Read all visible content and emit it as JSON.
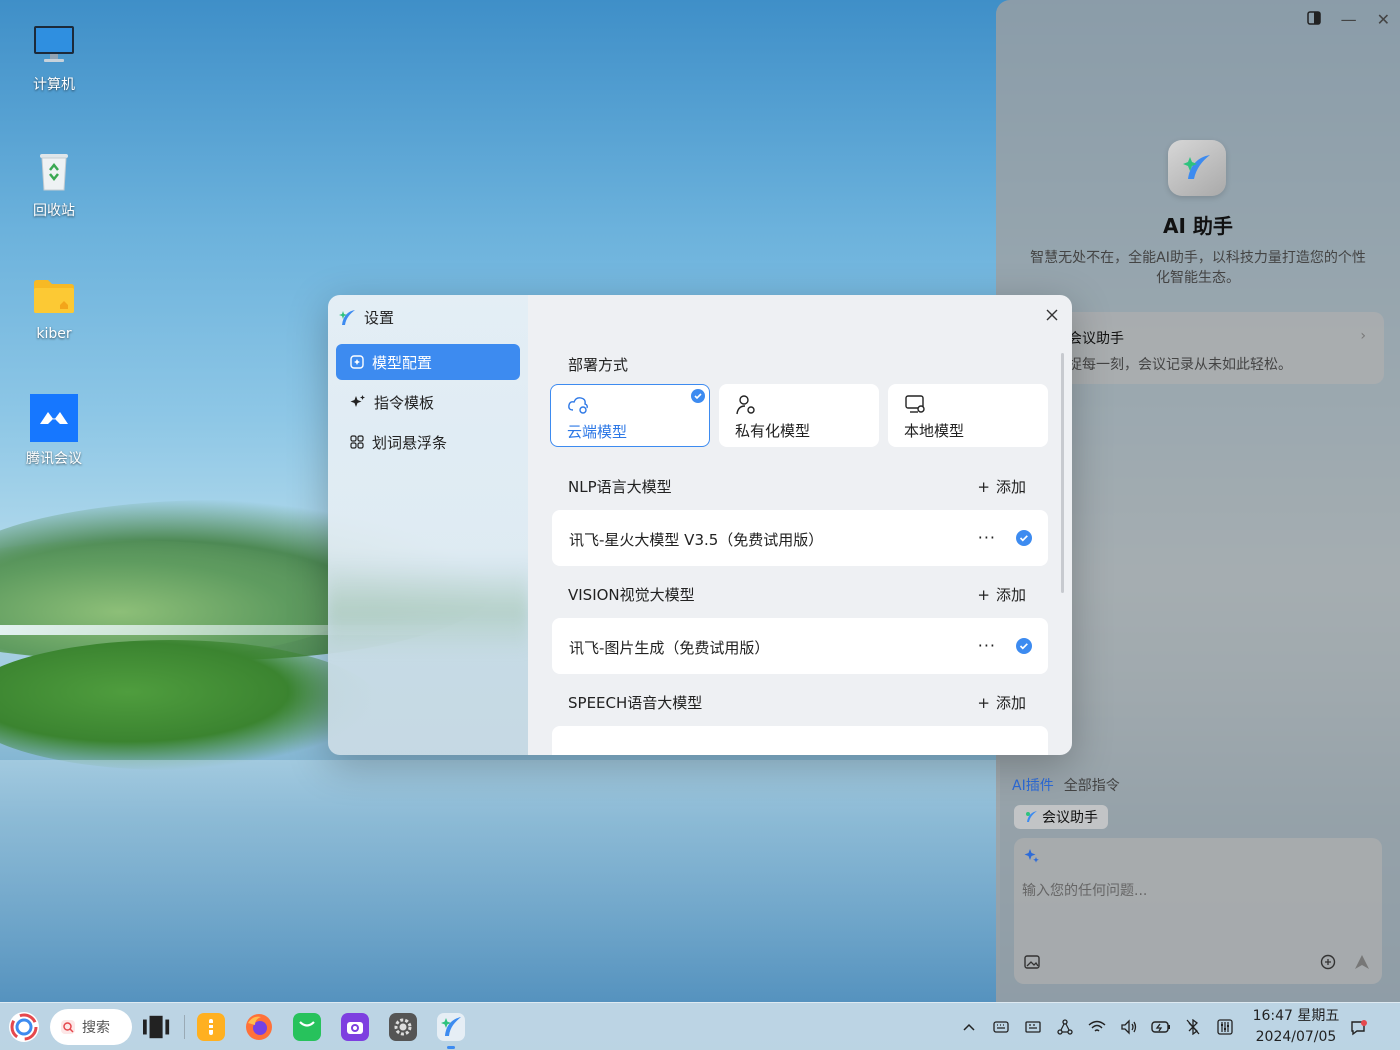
{
  "desktop": {
    "icons": [
      {
        "label": "计算机",
        "icon": "computer-icon"
      },
      {
        "label": "回收站",
        "icon": "trash-icon"
      },
      {
        "label": "kiber",
        "icon": "folder-icon"
      },
      {
        "label": "腾讯会议",
        "icon": "tencent-meeting-icon"
      }
    ]
  },
  "ai_panel": {
    "title": "AI 助手",
    "description": "智慧无处不在，全能AI助手，以科技力量打造您的个性化智能生态。",
    "plugin_card": {
      "title": "会议助手",
      "subtitle": "捉每一刻，会议记录从未如此轻松。"
    },
    "tabs": [
      "AI插件",
      "全部指令"
    ],
    "chip_label": "会议助手",
    "input_placeholder": "输入您的任何问题..."
  },
  "settings": {
    "title": "设置",
    "nav": [
      {
        "label": "模型配置",
        "icon": "model-config-icon",
        "active": true
      },
      {
        "label": "指令模板",
        "icon": "sparkle-icon",
        "active": false
      },
      {
        "label": "划词悬浮条",
        "icon": "grid-icon",
        "active": false
      }
    ],
    "deploy": {
      "section_title": "部署方式",
      "options": [
        {
          "label": "云端模型",
          "icon": "cloud-gear-icon",
          "selected": true
        },
        {
          "label": "私有化模型",
          "icon": "user-gear-icon",
          "selected": false
        },
        {
          "label": "本地模型",
          "icon": "monitor-gear-icon",
          "selected": false
        }
      ]
    },
    "add_label": "添加",
    "sections": [
      {
        "title": "NLP语言大模型",
        "models": [
          {
            "name": "讯飞-星火大模型 V3.5（免费试用版）",
            "checked": true
          }
        ]
      },
      {
        "title": "VISION视觉大模型",
        "models": [
          {
            "name": "讯飞-图片生成（免费试用版）",
            "checked": true
          }
        ]
      },
      {
        "title": "SPEECH语音大模型",
        "models": []
      }
    ],
    "more_label": "···"
  },
  "taskbar": {
    "search_label": "搜索",
    "clock_time": "16:47 星期五",
    "clock_date": "2024/07/05"
  },
  "colors": {
    "accent": "#3d8bf0",
    "panel_bg": "#a0a0a0",
    "dialog_main_bg": "#eef0f3"
  }
}
